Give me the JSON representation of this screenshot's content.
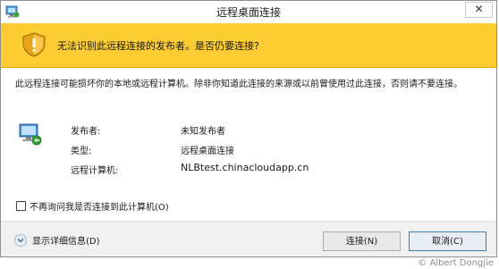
{
  "window": {
    "title": "远程桌面连接",
    "close_symbol": "✕"
  },
  "banner": {
    "text": "无法识别此远程连接的发布者。是否仍要连接?",
    "icon": "shield-warning-icon",
    "background": "#fccc33"
  },
  "description": "此远程连接可能损坏你的本地或远程计算机。除非你知道此连接的来源或以前曾使用过此连接，否则请不要连接。",
  "details": {
    "icon": "remote-computer-icon",
    "rows": [
      {
        "label": "发布者:",
        "value": "未知发布者"
      },
      {
        "label": "类型:",
        "value": "远程桌面连接"
      },
      {
        "label": "远程计算机:",
        "value": "NLBtest.chinacloudapp.cn"
      }
    ]
  },
  "checkbox": {
    "label": "不再询问我是否连接到此计算机(O)",
    "checked": false
  },
  "footer": {
    "details_toggle_label": "显示详细信息(D)",
    "connect_label": "连接(N)",
    "cancel_label": "取消(C)"
  },
  "watermark": "© Albert Dongjie"
}
